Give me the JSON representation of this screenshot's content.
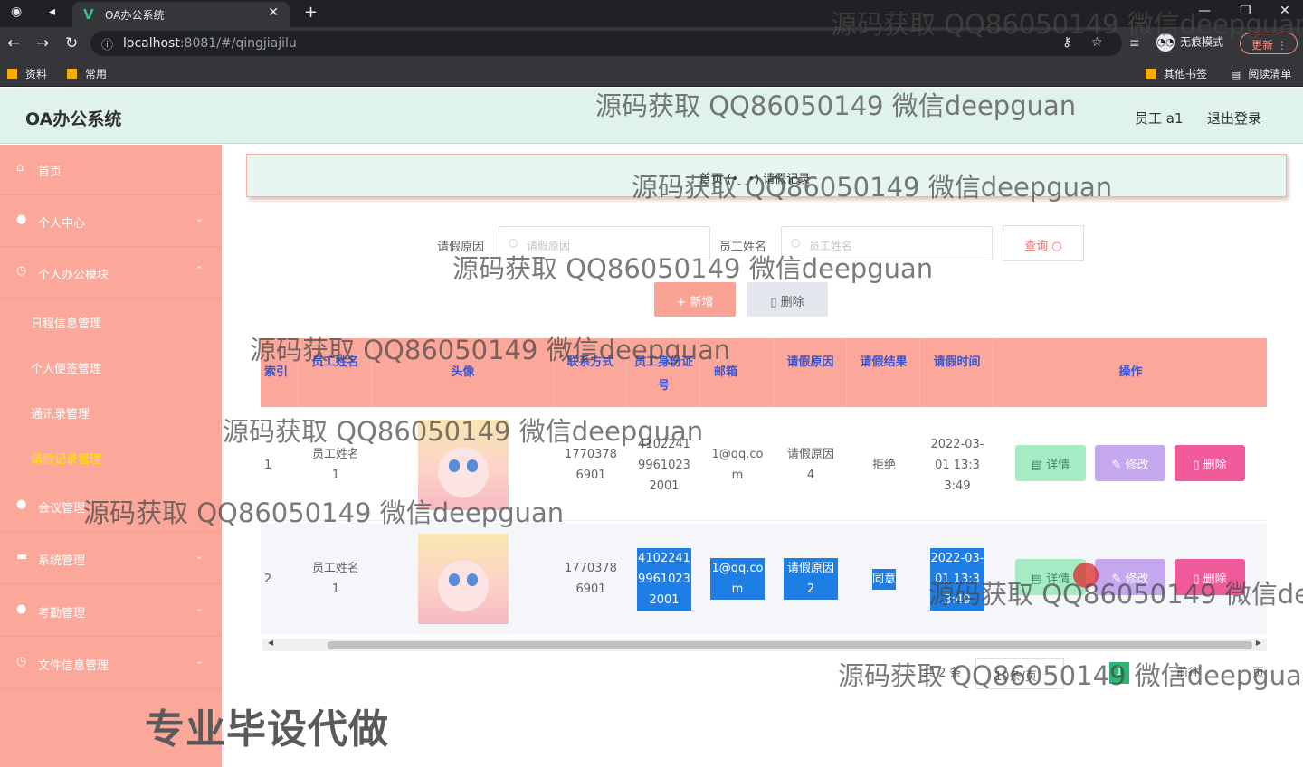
{
  "browser": {
    "tab_title": "OA办公系统",
    "url_host": "localhost",
    "url_rest": ":8081/#/qingjiajilu",
    "incognito_label": "无痕模式",
    "update_label": "更新",
    "bookmarks": [
      "资料",
      "常用"
    ],
    "bookmarks_right": [
      "其他书签",
      "阅读清单"
    ]
  },
  "header": {
    "brand": "OA办公系统",
    "user": "员工 a1",
    "logout": "退出登录"
  },
  "sidebar": {
    "items": [
      {
        "label": "首页",
        "icon": "home-icon",
        "arrow": ""
      },
      {
        "label": "个人中心",
        "icon": "person-icon",
        "arrow": "⌄"
      },
      {
        "label": "个人办公模块",
        "icon": "clock-icon",
        "arrow": "⌃"
      }
    ],
    "subitems": [
      "日程信息管理",
      "个人便签管理",
      "通讯录管理",
      "请假记录管理"
    ],
    "items2": [
      {
        "label": "会议管理",
        "icon": "person-icon",
        "arrow": ""
      },
      {
        "label": "系统管理",
        "icon": "window-icon",
        "arrow": "⌄"
      },
      {
        "label": "考勤管理",
        "icon": "person-icon",
        "arrow": "⌄"
      },
      {
        "label": "文件信息管理",
        "icon": "clock-icon",
        "arrow": "⌄"
      }
    ],
    "promo": "专业毕设代做"
  },
  "breadcrumb": "首页 (•‿•) 请假记录",
  "search": {
    "reason_label": "请假原因",
    "reason_placeholder": "请假原因",
    "name_label": "员工姓名",
    "name_placeholder": "员工姓名",
    "query_button": "查询"
  },
  "actions": {
    "add": "新增",
    "delete": "删除"
  },
  "table": {
    "headers": [
      "索引",
      "员工姓名",
      "头像",
      "联系方式",
      "员工身份证号",
      "邮箱",
      "请假原因",
      "请假结果",
      "请假时间",
      "操作"
    ],
    "rows": [
      {
        "index": "1",
        "name": "员工姓名1",
        "phone": "17703786901",
        "idcard": "410224199610232001",
        "email": "1@qq.com",
        "reason": "请假原因4",
        "result": "拒绝",
        "time": "2022-03-01 13:33:49"
      },
      {
        "index": "2",
        "name": "员工姓名1",
        "phone": "17703786901",
        "idcard": "410224199610232001",
        "email": "1@qq.com",
        "reason": "请假原因2",
        "result": "同意",
        "time": "2022-03-01 13:33:49"
      }
    ],
    "row_actions": {
      "detail": "详情",
      "edit": "修改",
      "remove": "删除"
    }
  },
  "pagination": {
    "total": "共 2 条",
    "page_size": "10条/页",
    "current_page": "1",
    "goto": "前往",
    "page_unit": "页"
  },
  "watermark": "源码获取 QQ86050149 微信deepguan"
}
